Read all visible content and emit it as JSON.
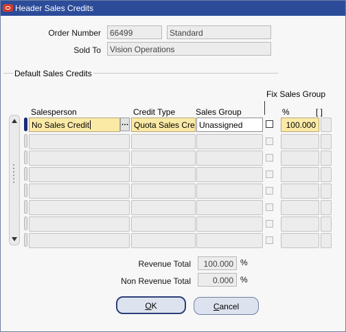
{
  "window": {
    "title": "Header Sales Credits"
  },
  "header": {
    "order_number_label": "Order Number",
    "order_number": "66499",
    "order_type": "Standard",
    "sold_to_label": "Sold To",
    "sold_to": "Vision Operations"
  },
  "section": {
    "title": "Default Sales Credits"
  },
  "table": {
    "columns": {
      "salesperson": "Salesperson",
      "credit_type": "Credit Type",
      "sales_group": "Sales Group",
      "fix_sales_group": "Fix Sales Group",
      "percent": "%",
      "flex": "[ ]"
    },
    "rows": [
      {
        "salesperson": "No Sales Credit",
        "credit_type": "Quota Sales Credit",
        "sales_group": "Unassigned",
        "percent": "100.000"
      }
    ],
    "empty_rows": 7
  },
  "totals": {
    "revenue_label": "Revenue Total",
    "revenue_value": "100.000",
    "revenue_unit": "%",
    "non_revenue_label": "Non Revenue Total",
    "non_revenue_value": "0.000",
    "non_revenue_unit": "%"
  },
  "buttons": {
    "ok_mnemonic": "O",
    "ok_rest": "K",
    "cancel_mnemonic": "C",
    "cancel_rest": "ancel"
  }
}
